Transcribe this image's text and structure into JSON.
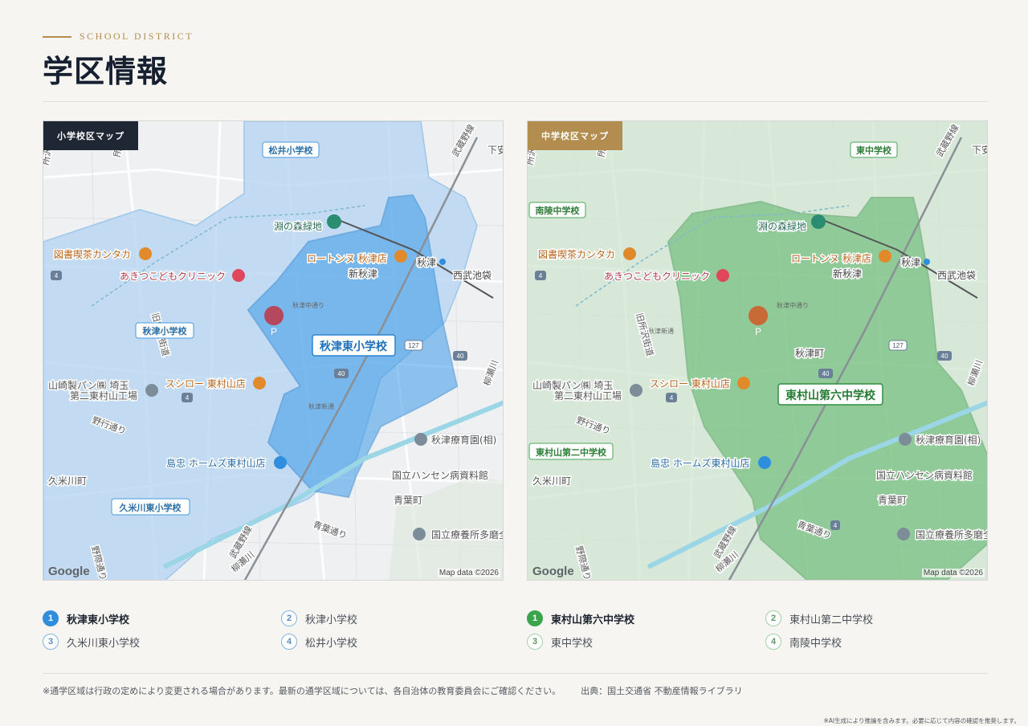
{
  "header": {
    "eyebrow": "SCHOOL DISTRICT",
    "title": "学区情報"
  },
  "colors": {
    "navy": "#1e2733",
    "gold": "#b38d4f",
    "elementary_fill": "#3b9be8",
    "junior_fill": "#3aa64b"
  },
  "elementary_map": {
    "tag": "小学校区マップ",
    "highlight_school": "秋津東小学校",
    "other_schools": [
      "松井小学校",
      "秋津小学校",
      "久米川東小学校"
    ],
    "attribution_logo": "Google",
    "attribution": "Map data ©2026"
  },
  "junior_map": {
    "tag": "中学校区マップ",
    "highlight_school": "東村山第六中学校",
    "other_schools": [
      "東中学校",
      "南陵中学校",
      "東村山第二中学校"
    ],
    "attribution_logo": "Google",
    "attribution": "Map data ©2026"
  },
  "map_labels": {
    "park": "淵の森緑地",
    "cafe": "図書喫茶カンタカ",
    "clinic": "あきつこどもクリニック",
    "restaurant1": "ロートンヌ 秋津店",
    "station1": "秋津",
    "station2": "新秋津",
    "line_west": "西武池袋",
    "street1": "秋津中通り",
    "street_new": "秋津新通",
    "town": "秋津町",
    "factory_l1": "山崎製パン㈱ 埼玉",
    "factory_l2": "第二東村山工場",
    "restaurant2": "スシロー 東村山店",
    "road_noko": "野行通り",
    "store": "島忠 ホームズ東村山店",
    "kumegawa": "久米川町",
    "aoba": "青葉町",
    "aoba_dori": "青葉通り",
    "nozaki": "野際通り",
    "sanatorium": "秋津療育園(相)",
    "hansen": "国立ハンセン病資料館",
    "tama": "国立療養所多磨全",
    "kaido": "旧所沢街道",
    "tokorozawa": "所沢街",
    "musashino": "武蔵野線",
    "yanase": "柳瀬川",
    "shimoyasu": "下安",
    "tokosaki": "所沢",
    "route4": "4",
    "route40": "40",
    "route127": "127",
    "parking": "P"
  },
  "legend_elementary": [
    {
      "num": "1",
      "name": "秋津東小学校"
    },
    {
      "num": "2",
      "name": "秋津小学校"
    },
    {
      "num": "3",
      "name": "久米川東小学校"
    },
    {
      "num": "4",
      "name": "松井小学校"
    }
  ],
  "legend_junior": [
    {
      "num": "1",
      "name": "東村山第六中学校"
    },
    {
      "num": "2",
      "name": "東村山第二中学校"
    },
    {
      "num": "3",
      "name": "東中学校"
    },
    {
      "num": "4",
      "name": "南陵中学校"
    }
  ],
  "footer": {
    "note": "※通学区域は行政の定めにより変更される場合があります。最新の通学区域については、各自治体の教育委員会にご確認ください。",
    "source": "出典：国土交通省 不動産情報ライブラリ",
    "ai_note": "※AI生成により推論を含みます。必要に応じて内容の確認を推奨します。"
  }
}
